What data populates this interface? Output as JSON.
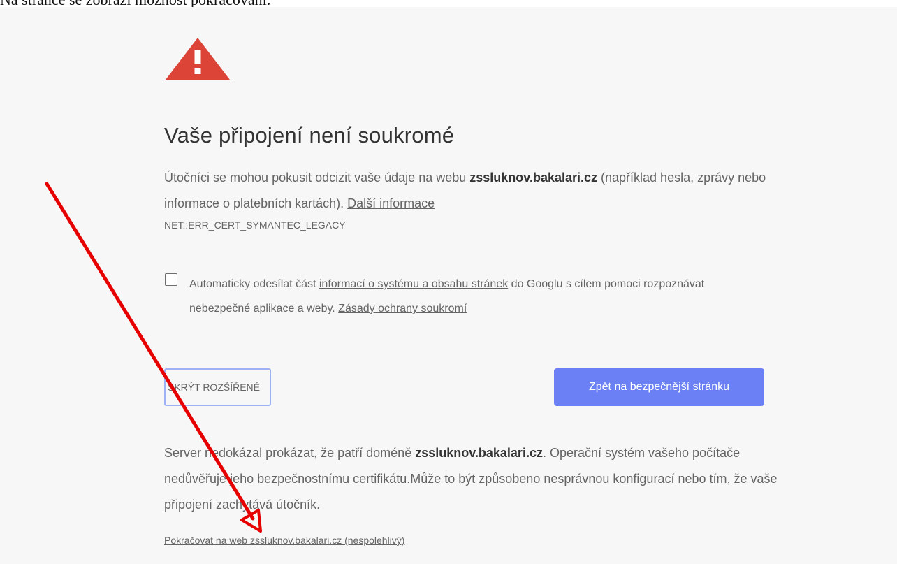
{
  "caption": "Na stránce se zobrazí možnost pokračování.",
  "icon": "warning-triangle-icon",
  "accent_color": "#6b80f4",
  "warning_color": "#db4437",
  "annotation_color": "#e60000",
  "title": "Vaše připojení není soukromé",
  "para1": {
    "text_before": "Útočníci se mohou pokusit odcizit vaše údaje na webu ",
    "domain": "zssluknov.bakalari.cz",
    "text_after": " (například hesla, zprávy nebo informace o platebních kartách). ",
    "link": "Další informace"
  },
  "error_code": "NET::ERR_CERT_SYMANTEC_LEGACY",
  "option": {
    "text_before": "Automaticky odesílat část ",
    "link1": "informací o systému a obsahu stránek",
    "text_mid": " do Googlu s cílem pomoci rozpoznávat nebezpečné aplikace a weby. ",
    "link2": "Zásady ochrany soukromí"
  },
  "buttons": {
    "hide_details": "SKRÝT ROZŠÍŘENÉ",
    "back": "Zpět na bezpečnější stránku"
  },
  "para2": {
    "text_before": "Server nedokázal prokázat, že patří doméně ",
    "domain": "zssluknov.bakalari.cz",
    "text_after": ". Operační systém vašeho počítače nedůvěřuje jeho bezpečnostnímu certifikátu.Může to být způsobeno nesprávnou konfigurací nebo tím, že vaše připojení zachytává útočník."
  },
  "proceed_link": "Pokračovat na web zssluknov.bakalari.cz (nespolehlivý)"
}
